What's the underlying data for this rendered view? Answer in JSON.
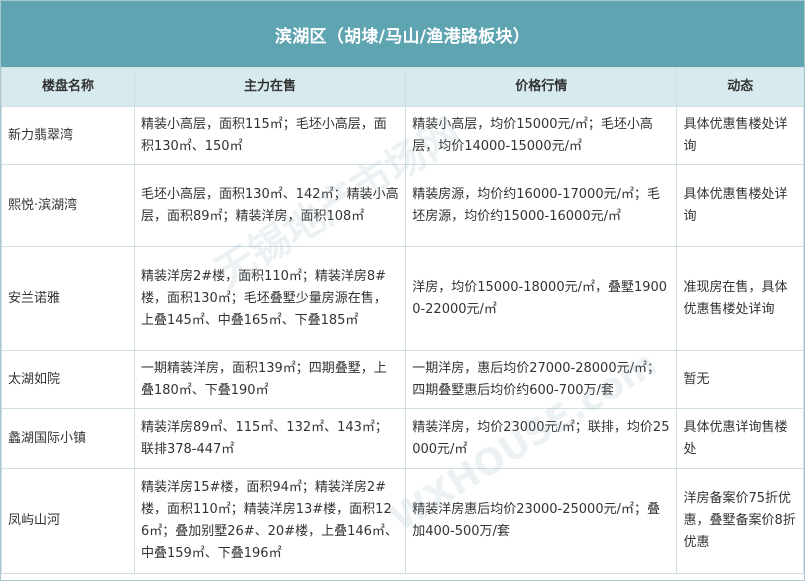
{
  "title": "滨湖区（胡埭/马山/渔港路板块）",
  "headers": [
    "楼盘名称",
    "主力在售",
    "价格行情",
    "动态"
  ],
  "rows": [
    {
      "name": "新力翡翠湾",
      "sale": "精装小高层，面积115㎡；毛坯小高层，面积130㎡、150㎡",
      "price": "精装小高层，均价15000元/㎡；毛坯小高层，均价14000-15000元/㎡",
      "status": "具体优惠售楼处详询"
    },
    {
      "name": "熙悦·滨湖湾",
      "sale": "毛坯小高层，面积130㎡、142㎡；精装小高层，面积89㎡；精装洋房，面积108㎡",
      "price": "精装房源，均价约16000-17000元/㎡；毛坯房源，均价约15000-16000元/㎡",
      "status": "具体优惠售楼处详询"
    },
    {
      "name": "安兰诺雅",
      "sale": "精装洋房2#楼，面积110㎡；精装洋房8#楼，面积130㎡；毛坯叠墅少量房源在售，上叠145㎡、中叠165㎡、下叠185㎡",
      "price": "洋房，均价15000-18000元/㎡，叠墅19000-22000元/㎡",
      "status": "准现房在售，具体优惠售楼处详询"
    },
    {
      "name": "太湖如院",
      "sale": "一期精装洋房，面积139㎡；四期叠墅，上叠180㎡、下叠190㎡",
      "price": "一期洋房，惠后均价27000-28000元/㎡；四期叠墅惠后均价约600-700万/套",
      "status": "暂无"
    },
    {
      "name": "蠡湖国际小镇",
      "sale": "精装洋房89㎡、115㎡、132㎡、143㎡；联排378-447㎡",
      "price": "精装洋房，均价23000元/㎡；联排，均价25000元/㎡",
      "status": "具体优惠详询售楼处"
    },
    {
      "name": "凤屿山河",
      "sale": "精装洋房15#楼，面积94㎡；精装洋房2#楼，面积110㎡；精装洋房13#楼，面积126㎡；叠加别墅26#、20#楼，上叠146㎡、中叠159㎡、下叠196㎡",
      "price": "精装洋房惠后均价23000-25000元/㎡；叠加400-500万/套",
      "status": "洋房备案价75折优惠，叠墅备案价8折优惠"
    }
  ],
  "watermark": {
    "line1": "无锡地产市场网",
    "line2": "WXHOUSE.com"
  }
}
